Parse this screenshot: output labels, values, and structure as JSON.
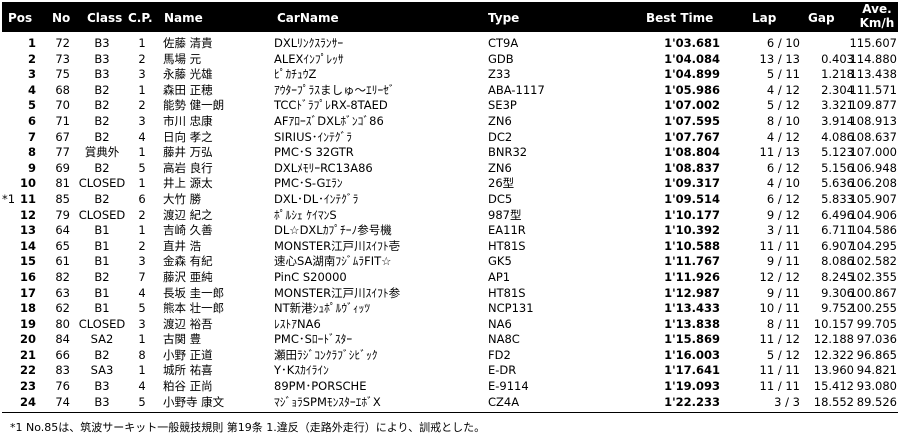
{
  "header": {
    "pos": "Pos",
    "no": "No",
    "class": "Class",
    "cp": "C.P.",
    "name": "Name",
    "car": "CarName",
    "type": "Type",
    "best": "Best Time",
    "lap": "Lap",
    "gap": "Gap",
    "ave_line1": "Ave.",
    "ave_line2": "Km/h"
  },
  "rows": [
    {
      "note": "",
      "pos": "1",
      "no": "72",
      "cls": "B3",
      "cp": "1",
      "name": "佐藤 清貴",
      "car": "DXLﾘﾝｸｽﾗﾝｻｰ",
      "type": "CT9A",
      "best": "1'03.681",
      "lap": "6 / 10",
      "gap": "",
      "ave": "115.607"
    },
    {
      "note": "",
      "pos": "2",
      "no": "73",
      "cls": "B3",
      "cp": "2",
      "name": "馬場 元",
      "car": "ALEXｲﾝﾌﾟﾚｯｻ",
      "type": "GDB",
      "best": "1'04.084",
      "lap": "13 / 13",
      "gap": "0.403",
      "ave": "114.880"
    },
    {
      "note": "",
      "pos": "3",
      "no": "75",
      "cls": "B3",
      "cp": "3",
      "name": "永藤 光雄",
      "car": "ﾋﾟｶﾁｭｳZ",
      "type": "Z33",
      "best": "1'04.899",
      "lap": "5 / 11",
      "gap": "1.218",
      "ave": "113.438"
    },
    {
      "note": "",
      "pos": "4",
      "no": "68",
      "cls": "B2",
      "cp": "1",
      "name": "森田 正穂",
      "car": "ｱｳﾀｰﾌﾟﾗｽましゅ～ｴﾘｰｾﾞ",
      "type": "ABA-1117",
      "best": "1'05.986",
      "lap": "4 / 12",
      "gap": "2.304",
      "ave": "111.571"
    },
    {
      "note": "",
      "pos": "5",
      "no": "70",
      "cls": "B2",
      "cp": "2",
      "name": "能勢 健一朗",
      "car": "TCCﾄﾞﾗﾌﾟﾚRX-8TAED",
      "type": "SE3P",
      "best": "1'07.002",
      "lap": "5 / 12",
      "gap": "3.321",
      "ave": "109.877"
    },
    {
      "note": "",
      "pos": "6",
      "no": "71",
      "cls": "B2",
      "cp": "3",
      "name": "市川 忠康",
      "car": "AFｱﾛｰｽﾞDXLﾎﾞﾝｺﾞ86",
      "type": "ZN6",
      "best": "1'07.595",
      "lap": "8 / 10",
      "gap": "3.914",
      "ave": "108.913"
    },
    {
      "note": "",
      "pos": "7",
      "no": "67",
      "cls": "B2",
      "cp": "4",
      "name": "日向 孝之",
      "car": "SIRIUS･ｲﾝﾃｸﾞﾗ",
      "type": "DC2",
      "best": "1'07.767",
      "lap": "4 / 12",
      "gap": "4.086",
      "ave": "108.637"
    },
    {
      "note": "",
      "pos": "8",
      "no": "77",
      "cls": "賞典外",
      "cp": "1",
      "name": "藤井 万弘",
      "car": "PMC･S 32GTR",
      "type": "BNR32",
      "best": "1'08.804",
      "lap": "11 / 13",
      "gap": "5.123",
      "ave": "107.000"
    },
    {
      "note": "",
      "pos": "9",
      "no": "69",
      "cls": "B2",
      "cp": "5",
      "name": "高岩 良行",
      "car": "DXLﾒﾓﾘｰRC13A86",
      "type": "ZN6",
      "best": "1'08.837",
      "lap": "6 / 12",
      "gap": "5.156",
      "ave": "106.948"
    },
    {
      "note": "",
      "pos": "10",
      "no": "81",
      "cls": "CLOSED",
      "cp": "1",
      "name": "井上 源太",
      "car": "PMC･S-Gｴﾗﾝ",
      "type": "26型",
      "best": "1'09.317",
      "lap": "4 / 10",
      "gap": "5.636",
      "ave": "106.208"
    },
    {
      "note": "*1",
      "pos": "11",
      "no": "85",
      "cls": "B2",
      "cp": "6",
      "name": "大竹 勝",
      "car": "DXL･DL･ｲﾝﾃｸﾞﾗ",
      "type": "DC5",
      "best": "1'09.514",
      "lap": "6 / 12",
      "gap": "5.833",
      "ave": "105.907"
    },
    {
      "note": "",
      "pos": "12",
      "no": "79",
      "cls": "CLOSED",
      "cp": "2",
      "name": "渡辺 紀之",
      "car": "ﾎﾟﾙｼｪ ｹｲﾏﾝS",
      "type": "987型",
      "best": "1'10.177",
      "lap": "9 / 12",
      "gap": "6.496",
      "ave": "104.906"
    },
    {
      "note": "",
      "pos": "13",
      "no": "64",
      "cls": "B1",
      "cp": "1",
      "name": "吉崎 久善",
      "car": "DL☆DXLｶﾌﾟﾁｰﾉ参号機",
      "type": "EA11R",
      "best": "1'10.392",
      "lap": "3 / 11",
      "gap": "6.711",
      "ave": "104.586"
    },
    {
      "note": "",
      "pos": "14",
      "no": "65",
      "cls": "B1",
      "cp": "2",
      "name": "直井 浩",
      "car": "MONSTER江戸川ｽｲﾌﾄ壱",
      "type": "HT81S",
      "best": "1'10.588",
      "lap": "11 / 11",
      "gap": "6.907",
      "ave": "104.295"
    },
    {
      "note": "",
      "pos": "15",
      "no": "61",
      "cls": "B1",
      "cp": "3",
      "name": "金森 有紀",
      "car": "速心SA湖南ﾌｼﾞﾑﾗFIT☆",
      "type": "GK5",
      "best": "1'11.767",
      "lap": "9 / 11",
      "gap": "8.086",
      "ave": "102.582"
    },
    {
      "note": "",
      "pos": "16",
      "no": "82",
      "cls": "B2",
      "cp": "7",
      "name": "藤沢 亜純",
      "car": "PinC S20000",
      "type": "AP1",
      "best": "1'11.926",
      "lap": "12 / 12",
      "gap": "8.245",
      "ave": "102.355"
    },
    {
      "note": "",
      "pos": "17",
      "no": "63",
      "cls": "B1",
      "cp": "4",
      "name": "長坂 圭一郎",
      "car": "MONSTER江戸川ｽｲﾌﾄ参",
      "type": "HT81S",
      "best": "1'12.987",
      "lap": "9 / 11",
      "gap": "9.306",
      "ave": "100.867"
    },
    {
      "note": "",
      "pos": "18",
      "no": "62",
      "cls": "B1",
      "cp": "5",
      "name": "熊本 壮一郎",
      "car": "NT新港ｼｭﾎﾟﾙｳﾞｨｯﾂ",
      "type": "NCP131",
      "best": "1'13.433",
      "lap": "10 / 11",
      "gap": "9.752",
      "ave": "100.255"
    },
    {
      "note": "",
      "pos": "19",
      "no": "80",
      "cls": "CLOSED",
      "cp": "3",
      "name": "渡辺 裕吾",
      "car": "ﾚｽﾄｱNA6",
      "type": "NA6",
      "best": "1'13.838",
      "lap": "8 / 11",
      "gap": "10.157",
      "ave": "99.705"
    },
    {
      "note": "",
      "pos": "20",
      "no": "84",
      "cls": "SA2",
      "cp": "1",
      "name": "古関 豊",
      "car": "PMC･Sﾛｰﾄﾞｽﾀｰ",
      "type": "NA8C",
      "best": "1'15.869",
      "lap": "11 / 12",
      "gap": "12.188",
      "ave": "97.036"
    },
    {
      "note": "",
      "pos": "21",
      "no": "66",
      "cls": "B2",
      "cp": "8",
      "name": "小野 正道",
      "car": "瀬田ﾗｼﾞｺﾝｸﾗﾌﾞｼﾋﾞｯｸ",
      "type": "FD2",
      "best": "1'16.003",
      "lap": "5 / 12",
      "gap": "12.322",
      "ave": "96.865"
    },
    {
      "note": "",
      "pos": "22",
      "no": "83",
      "cls": "SA3",
      "cp": "1",
      "name": "城所 祐喜",
      "car": "Y･Kｽｶｲﾗｲﾝ",
      "type": "E-DR",
      "best": "1'17.641",
      "lap": "11 / 11",
      "gap": "13.960",
      "ave": "94.821"
    },
    {
      "note": "",
      "pos": "23",
      "no": "76",
      "cls": "B3",
      "cp": "4",
      "name": "粕谷 正尚",
      "car": "89PM･PORSCHE",
      "type": "E-9114",
      "best": "1'19.093",
      "lap": "11 / 11",
      "gap": "15.412",
      "ave": "93.080"
    },
    {
      "note": "",
      "pos": "24",
      "no": "74",
      "cls": "B3",
      "cp": "5",
      "name": "小野寺 康文",
      "car": "ﾏｼﾞｮﾗSPMﾓﾝｽﾀｰｴﾎﾞX",
      "type": "CZ4A",
      "best": "1'22.233",
      "lap": "3 / 3",
      "gap": "18.552",
      "ave": "89.526"
    }
  ],
  "footnote": "*1 No.85は、筑波サーキット一般競技規則 第19条 1.違反（走路外走行）により、訓戒とした。"
}
